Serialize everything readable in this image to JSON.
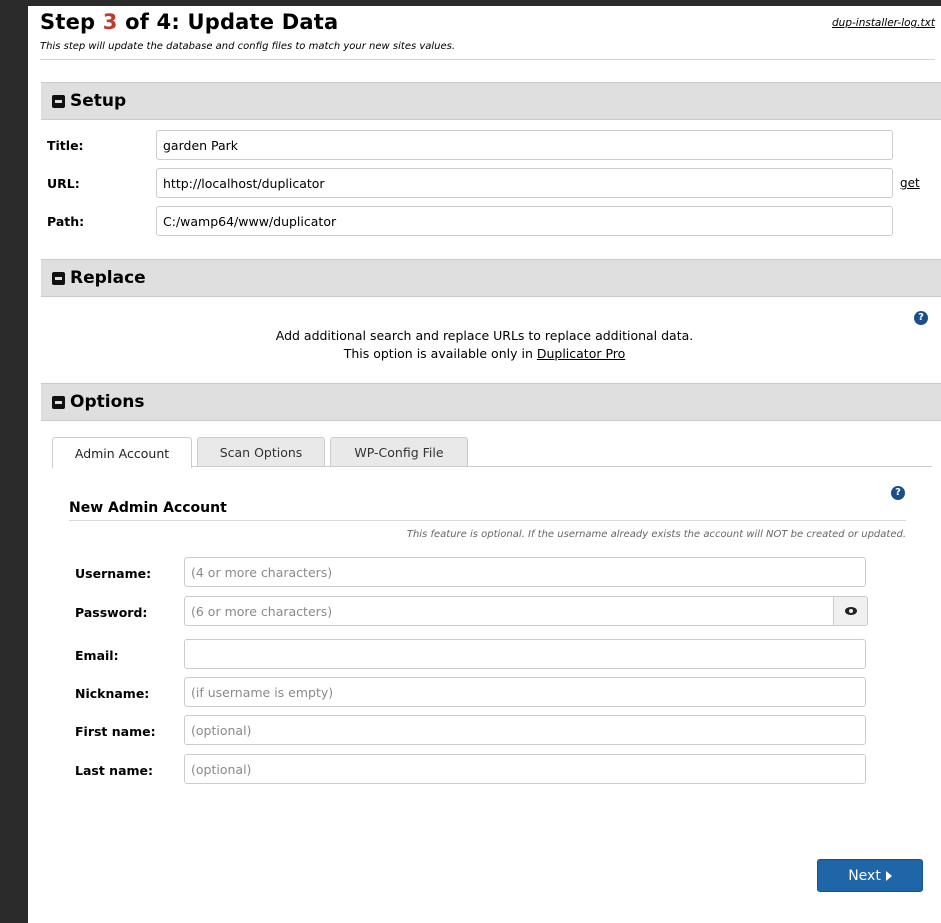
{
  "header": {
    "step_prefix": "Step ",
    "step_number": "3",
    "step_suffix": " of 4: Update Data",
    "subtitle": "This step will update the database and config files to match your new sites values.",
    "log_link": "dup-installer-log.txt"
  },
  "setup": {
    "title": "Setup",
    "fields": {
      "title": {
        "label": "Title:",
        "value": "garden Park"
      },
      "url": {
        "label": "URL:",
        "value": "http://localhost/duplicator",
        "action": "get"
      },
      "path": {
        "label": "Path:",
        "value": "C:/wamp64/www/duplicator"
      }
    }
  },
  "replace": {
    "title": "Replace",
    "line1": "Add additional search and replace URLs to replace additional data.",
    "line2_prefix": "This option is available only in ",
    "line2_link": "Duplicator Pro"
  },
  "options": {
    "title": "Options",
    "tabs": [
      "Admin Account",
      "Scan Options",
      "WP-Config File"
    ],
    "active_tab": 0,
    "admin": {
      "heading": "New Admin Account",
      "note": "This feature is optional. If the username already exists the account will NOT be created or updated.",
      "username": {
        "label": "Username:",
        "value": "",
        "placeholder": "(4 or more characters)"
      },
      "password": {
        "label": "Password:",
        "value": "",
        "placeholder": "(6 or more characters)"
      },
      "email": {
        "label": "Email:",
        "value": "",
        "placeholder": ""
      },
      "nickname": {
        "label": "Nickname:",
        "value": "",
        "placeholder": "(if username is empty)"
      },
      "first_name": {
        "label": "First name:",
        "value": "",
        "placeholder": "(optional)"
      },
      "last_name": {
        "label": "Last name:",
        "value": "",
        "placeholder": "(optional)"
      }
    }
  },
  "footer": {
    "next_label": "Next"
  },
  "colors": {
    "accent": "#1f66a8",
    "step_number": "#c0392b",
    "section_bar": "#dfdfdf"
  },
  "icons": [
    "minus-square-icon",
    "question-circle-icon",
    "eye-icon",
    "caret-right-icon"
  ]
}
